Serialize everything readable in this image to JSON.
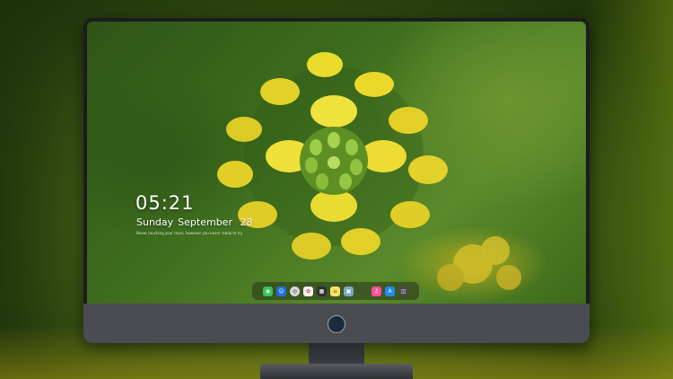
{
  "lock_screen": {
    "time": "05:21",
    "day": "Sunday",
    "month": "September",
    "date": "28",
    "quote": "Never touching your tears, however you never ready to try"
  },
  "dock": {
    "items": [
      {
        "name": "messages",
        "color": "#34c759",
        "glyph": "💬"
      },
      {
        "name": "finder",
        "color": "#1f6fe0",
        "glyph": "☺"
      },
      {
        "name": "safari",
        "color": "#d9d9d9",
        "glyph": "◎"
      },
      {
        "name": "photos",
        "color": "#f2f2f2",
        "glyph": "✿"
      },
      {
        "name": "clapper",
        "color": "#303030",
        "glyph": "▦"
      },
      {
        "name": "notes",
        "color": "#fbe36a",
        "glyph": "≡"
      },
      {
        "name": "preview",
        "color": "#7aa8c9",
        "glyph": "▣"
      },
      {
        "name": "music",
        "color": "#ff4f9a",
        "glyph": "♫"
      },
      {
        "name": "app-store",
        "color": "#1c8cf2",
        "glyph": "A"
      },
      {
        "name": "screenshot",
        "color": "#4a4a4a",
        "glyph": "◫"
      }
    ]
  },
  "colors": {
    "flower_yellow": "#e8d62a",
    "bud_green": "#8ebd3a",
    "monitor_bezel": "#1b1c20",
    "monitor_chin": "#4a4c52"
  }
}
